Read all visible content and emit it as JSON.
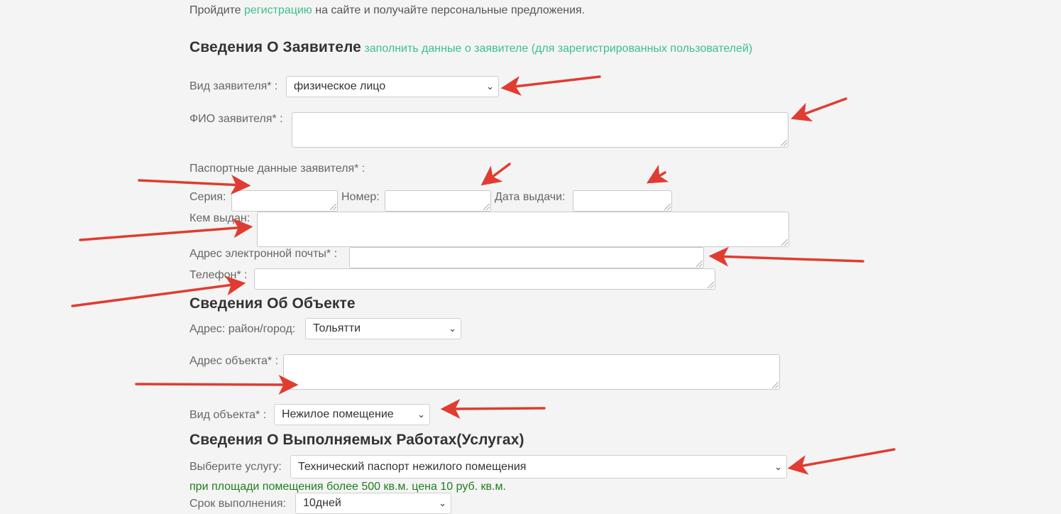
{
  "intro": {
    "before": "Пройдите ",
    "link": "регистрацию",
    "after": " на сайте и получайте персональные предложения."
  },
  "applicant": {
    "title": "Сведения О Заявителе",
    "fill_link": "заполнить данные о заявителе (для зарегистрированных пользователей)",
    "type_label": "Вид заявителя* :",
    "type_value": "физическое лицо",
    "fio_label": "ФИО заявителя* :",
    "passport_label": "Паспортные данные заявителя* :",
    "series_label": "Серия:",
    "number_label": "Номер:",
    "issue_date_label": "Дата выдачи:",
    "issued_by_label": "Кем выдан:",
    "email_label": "Адрес электронной почты* :",
    "phone_label": "Телефон* :"
  },
  "object": {
    "title": "Сведения Об Объекте",
    "city_label": "Адрес: район/город:",
    "city_value": "Тольятти",
    "address_label": "Адрес объекта* :",
    "type_label": "Вид объекта* :",
    "type_value": "Нежилое помещение"
  },
  "works": {
    "title": "Сведения О Выполняемых Работах(Услугах)",
    "service_label": "Выберите услугу:",
    "service_value": "Технический паспорт нежилого помещения",
    "price_note": "при площади помещения более 500 кв.м. цена 10 руб. кв.м.",
    "term_label": "Срок выполнения:",
    "term_value": "10дней"
  },
  "colors": {
    "accent_link": "#3cc08c",
    "arrow": "#e03c31",
    "note_green": "#1f7d1f",
    "background": "#f4f4f4"
  },
  "icons": {
    "select_chevron": "chevron-down-icon",
    "annotation": "red-arrow-icon"
  }
}
